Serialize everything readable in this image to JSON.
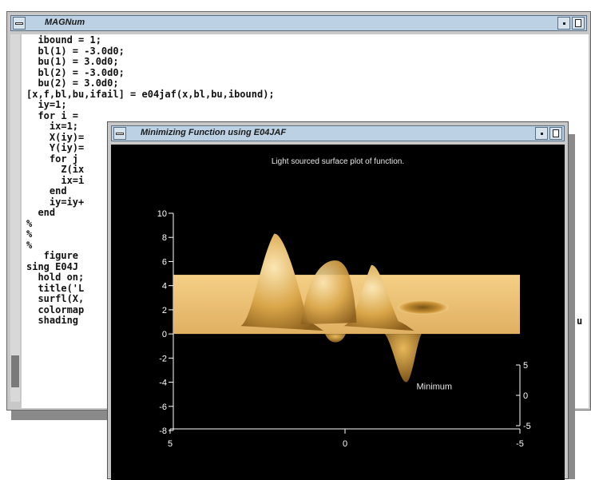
{
  "code_window": {
    "title": "MAGNum",
    "lines": [
      "  ibound = 1;",
      "  bl(1) = -3.0d0;",
      "  bu(1) = 3.0d0;",
      "  bl(2) = -3.0d0;",
      "  bu(2) = 3.0d0;",
      "[x,f,bl,bu,ifail] = e04jaf(x,bl,bu,ibound);",
      "  iy=1;",
      "  for i = ",
      "    ix=1;",
      "    X(iy)=",
      "    Y(iy)=",
      "    for j ",
      "      Z(ix",
      "      ix=i",
      "    end",
      "    iy=iy+",
      "  end",
      "%",
      "%",
      "%",
      "   figure ",
      "sing E04J",
      "  hold on;",
      "  title('L",
      "  surfl(X,",
      "  colormap",
      "  shading "
    ],
    "overflow_text": "u"
  },
  "plot_window": {
    "title": "Minimizing Function using E04JAF",
    "plot_title": "Light sourced surface plot of function.",
    "annotation": "Minimum"
  },
  "chart_data": {
    "type": "surface",
    "title": "Light sourced surface plot of function.",
    "xlabel": "",
    "ylabel": "",
    "zlabel": "",
    "x_ticks": [
      "5",
      "0",
      "-5"
    ],
    "z_ticks": [
      "-8",
      "-6",
      "-4",
      "-2",
      "0",
      "2",
      "4",
      "6",
      "8",
      "10"
    ],
    "y_ticks": [
      "-5",
      "0",
      "5"
    ],
    "zlim": [
      -8,
      10
    ],
    "peaks": [
      {
        "x": 2.0,
        "z": 8.3
      },
      {
        "x": -0.8,
        "z": 5.7
      },
      {
        "x": -2.2,
        "z": 0.2
      }
    ],
    "minimum": {
      "label": "Minimum",
      "z": -4.0
    },
    "colormap": "copper",
    "colors": {
      "surface_light": "#f6d28a",
      "surface_mid": "#d9a548",
      "surface_dark": "#7a5212",
      "background": "#000000",
      "axes": "#ffffff"
    }
  }
}
